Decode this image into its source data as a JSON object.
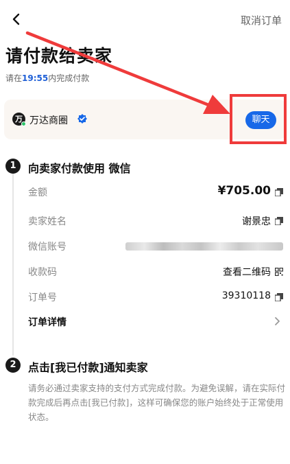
{
  "header": {
    "back_icon": "chevron-left-icon",
    "cancel_label": "取消订单"
  },
  "title": "请付款给卖家",
  "deadline": {
    "prefix": "请在",
    "time": "19:55",
    "suffix": "内完成付款"
  },
  "seller": {
    "logo_char": "万",
    "name": "万达商圈",
    "verified_icon": "verified-badge-icon",
    "chat_label": "聊天"
  },
  "step1": {
    "number": "1",
    "title": "向卖家付款使用 微信",
    "rows": {
      "amount": {
        "label": "金额",
        "value": "¥705.00"
      },
      "seller_name": {
        "label": "卖家姓名",
        "value": "谢景忠"
      },
      "wechat_account": {
        "label": "微信账号"
      },
      "qr": {
        "label": "收款码",
        "value": "查看二维码"
      },
      "order_no": {
        "label": "订单号",
        "value": "39310118"
      },
      "details": {
        "label": "订单详情"
      }
    }
  },
  "step2": {
    "number": "2",
    "title": "点击[我已付款]通知卖家",
    "description": "请务必通过卖家支持的支付方式完成付款。为避免误解，请在实际付款完成后再点击[我已付款]，这样可确保您的账户始终处于正常使用状态。"
  },
  "colors": {
    "accent": "#1768e8",
    "highlight": "#ef3b3b",
    "link": "#1f5fd6"
  }
}
